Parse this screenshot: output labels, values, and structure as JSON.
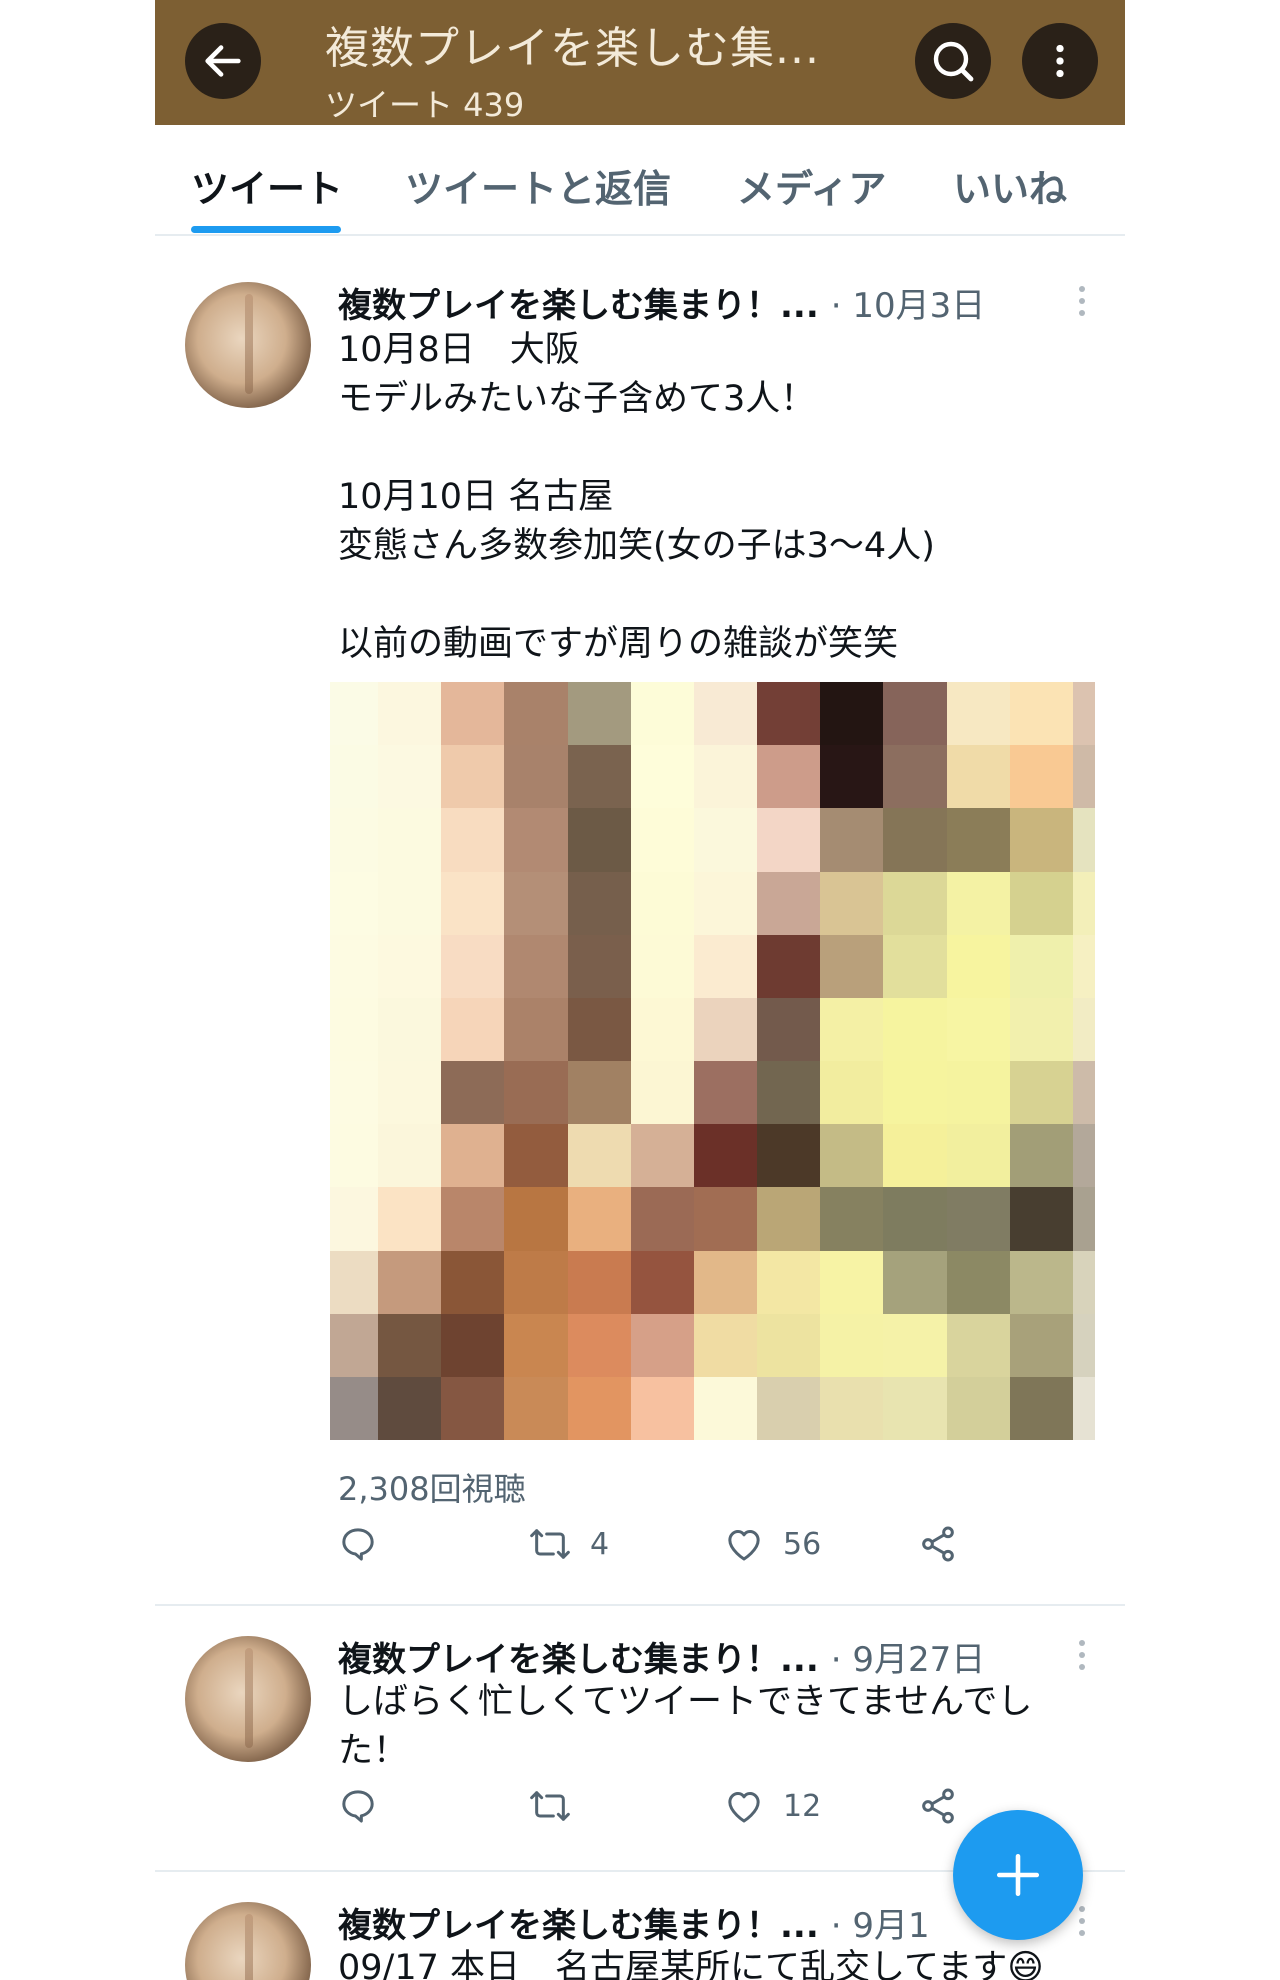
{
  "header": {
    "title": "複数プレイを楽しむ集...",
    "subtitle": "ツイート 439",
    "colors": {
      "bar": "#7d5f33",
      "button": "#2a2118",
      "text": "#f3ead9"
    }
  },
  "tabs": [
    {
      "label": "ツイート",
      "active": true
    },
    {
      "label": "ツイートと返信",
      "active": false
    },
    {
      "label": "メディア",
      "active": false
    },
    {
      "label": "いいね",
      "active": false
    }
  ],
  "tweets": [
    {
      "name": "複数プレイを楽しむ集まり！...",
      "date": "· 10月3日",
      "text": "10月8日　大阪\nモデルみたいな子含めて3人！\n\n10月10日 名古屋\n変態さん多数参加笑(女の子は3〜4人)\n\n以前の動画ですが周りの雑談が笑笑",
      "has_media": true,
      "views": "2,308回視聴",
      "retweets": "4",
      "likes": "56"
    },
    {
      "name": "複数プレイを楽しむ集まり！...",
      "date": "· 9月27日",
      "text": "しばらく忙しくてツイートできてませんでし\nた！",
      "retweets": "",
      "likes": "12"
    },
    {
      "name": "複数プレイを楽しむ集まり！...",
      "date": "· 9月1",
      "text": "09/17 本日　名古屋某所にて乱交してます😄"
    }
  ],
  "icons": {
    "back": "arrow-left-icon",
    "search": "search-icon",
    "more": "more-vertical-icon",
    "reply": "reply-icon",
    "retweet": "retweet-icon",
    "like": "heart-icon",
    "share": "share-icon",
    "compose": "plus-icon"
  },
  "accent_color": "#1d9bf0",
  "media_mosaic": [
    [
      "#fbfbe6",
      "#fcf7df",
      "#e4b79a",
      "#a9826a",
      "#a39a7f",
      "#fdfcd8",
      "#f8ead4",
      "#733f36",
      "#231512",
      "#86645a",
      "#f7e8c2",
      "#fbe3b4",
      "#dcc3b0"
    ],
    [
      "#fbfbe4",
      "#fcf9e1",
      "#efcaab",
      "#a8826b",
      "#7a634f",
      "#fefdda",
      "#fbf4d9",
      "#cd9c8a",
      "#281615",
      "#8c6e5f",
      "#f0dba8",
      "#f9c993",
      "#cfbaa7"
    ],
    [
      "#fcfbe3",
      "#fcfae0",
      "#f8dcc0",
      "#b28a73",
      "#6c5a46",
      "#fefcd8",
      "#fbf8dc",
      "#f3d6c6",
      "#a58c72",
      "#857557",
      "#8b7d58",
      "#c9b57d",
      "#e5e3bf"
    ],
    [
      "#fdfce3",
      "#fcfae0",
      "#fae3c6",
      "#b48f77",
      "#765f4c",
      "#fdfbd6",
      "#fcf6d9",
      "#c9a796",
      "#d9c494",
      "#dcd897",
      "#f4f2a4",
      "#d5d18f",
      "#f3efb9"
    ],
    [
      "#fdfbe2",
      "#fdf9df",
      "#f8dcc3",
      "#b08870",
      "#7a5f4c",
      "#fdfad6",
      "#fbebd0",
      "#6e3b31",
      "#b9a07b",
      "#e2df9c",
      "#f7f49f",
      "#eff0ac",
      "#f6f0c2"
    ],
    [
      "#fdfbe1",
      "#fbf8dd",
      "#f6d5b9",
      "#ab8269",
      "#7a5843",
      "#fdf8d4",
      "#ebd3bd",
      "#735a4c",
      "#f4f0a5",
      "#f6f49f",
      "#f7f5a3",
      "#f2f0ad",
      "#f2ecc4"
    ],
    [
      "#fdfbe2",
      "#fcf8dd",
      "#8d6b57",
      "#996c54",
      "#a18163",
      "#fcf6d3",
      "#9c6f61",
      "#726650",
      "#f2ed9f",
      "#f6f49e",
      "#f5f39f",
      "#d7d292",
      "#cdbba9"
    ],
    [
      "#fdfbe1",
      "#fbf6db",
      "#dfb190",
      "#935c3e",
      "#eedbb0",
      "#d5b096",
      "#6b3028",
      "#4c3928",
      "#c4bb86",
      "#f5f09a",
      "#f2ef9e",
      "#a29e77",
      "#b3a89a"
    ],
    [
      "#fcf7df",
      "#fbe3c4",
      "#b9866a",
      "#b87642",
      "#e9b07f",
      "#9b6a55",
      "#a16d53",
      "#baa676",
      "#868160",
      "#7e7c5f",
      "#807c63",
      "#483e30",
      "#a9a190"
    ],
    [
      "#ecdcc2",
      "#c59a7d",
      "#8a5637",
      "#be7b48",
      "#c97b50",
      "#95543f",
      "#e2b889",
      "#f3e7a4",
      "#f7f3a5",
      "#a5a27c",
      "#8c8964",
      "#bbb78b",
      "#d8d3bb"
    ],
    [
      "#c1a794",
      "#755741",
      "#6e4330",
      "#c98650",
      "#dc8b5e",
      "#d6a088",
      "#f0dca3",
      "#ede3a0",
      "#f5f2a6",
      "#f5f2a8",
      "#d9d49d",
      "#a8a17a",
      "#d6d2be"
    ],
    [
      "#968c88",
      "#5f4b3e",
      "#855742",
      "#c98a57",
      "#e29561",
      "#f7c1a0",
      "#fcf9d9",
      "#d9cfae",
      "#e9e0ae",
      "#e8e4b0",
      "#d3cf9a",
      "#7f7658",
      "#e6e2d3"
    ]
  ]
}
